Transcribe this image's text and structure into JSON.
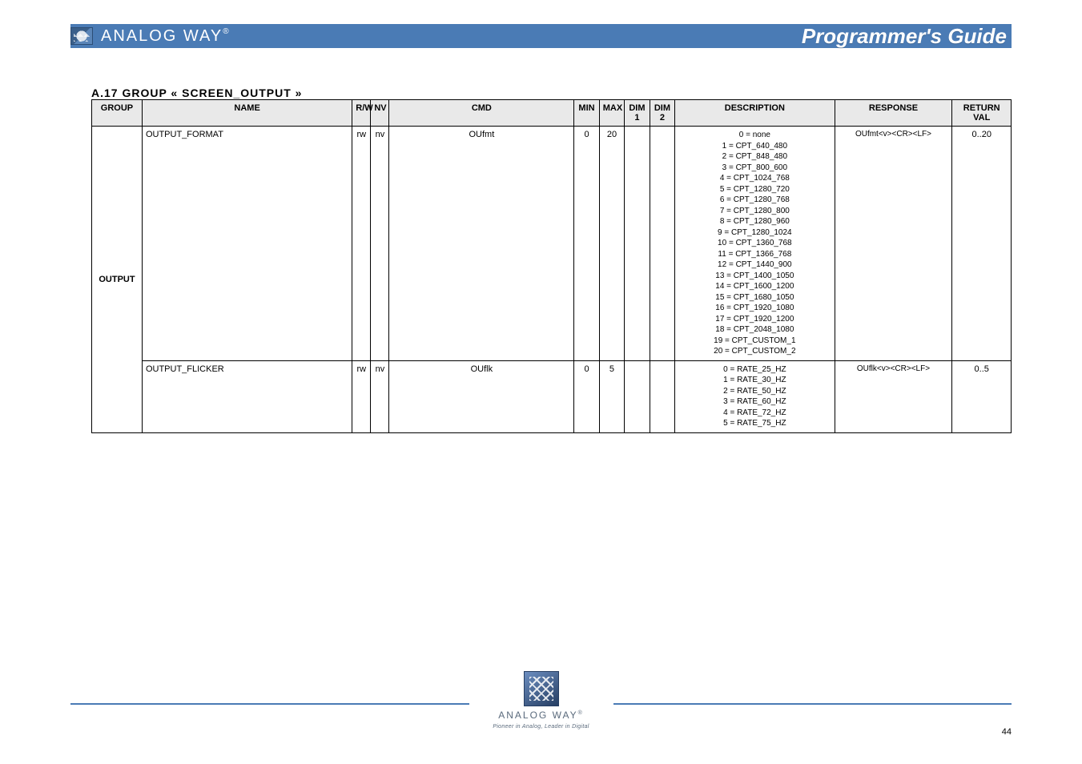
{
  "header": {
    "brand": "ANALOG WAY",
    "brand_reg": "®",
    "title": "Programmer's Guide"
  },
  "section_caption": "A.17 GROUP « SCREEN_OUTPUT »",
  "columns": [
    "GROUP",
    "NAME",
    "R/W",
    "NV",
    "CMD",
    "MIN",
    "MAX",
    "DIM 1",
    "DIM 2",
    "DESCRIPTION",
    "RESPONSE",
    "RETURN VAL"
  ],
  "rows": [
    {
      "group": "OUTPUT",
      "name": "OUTPUT_FORMAT",
      "rw": "rw",
      "nv": "nv",
      "cmd": "OUfmt",
      "min": "0",
      "max": "20",
      "d1": null,
      "d2": null,
      "desc": [
        "0 = none",
        "1 = CPT_640_480",
        "2 = CPT_848_480",
        "3 = CPT_800_600",
        "4 = CPT_1024_768",
        "5 = CPT_1280_720",
        "6 = CPT_1280_768",
        "7 = CPT_1280_800",
        "8 = CPT_1280_960",
        "9 = CPT_1280_1024",
        "10 = CPT_1360_768",
        "11 = CPT_1366_768",
        "12 = CPT_1440_900",
        "13 = CPT_1400_1050",
        "14 = CPT_1600_1200",
        "15 = CPT_1680_1050",
        "16 = CPT_1920_1080",
        "17 = CPT_1920_1200",
        "18 = CPT_2048_1080",
        "19 = CPT_CUSTOM_1",
        "20 = CPT_CUSTOM_2"
      ],
      "resp": "OUfmt<v><CR><LF>",
      "ret": "0..20"
    },
    {
      "group": "OUTPUT",
      "name": "OUTPUT_FLICKER",
      "rw": "rw",
      "nv": "nv",
      "cmd": "OUflk",
      "min": "0",
      "max": "5",
      "d1": null,
      "d2": null,
      "desc": [
        "0 = RATE_25_HZ",
        "1 = RATE_30_HZ",
        "2 = RATE_50_HZ",
        "3 = RATE_60_HZ",
        "4 = RATE_72_HZ",
        "5 = RATE_75_HZ"
      ],
      "resp": "OUflk<v><CR><LF>",
      "ret": "0..5"
    }
  ],
  "footer": {
    "brand": "ANALOG WAY",
    "brand_reg": "®",
    "tagline": "Pioneer in Analog, Leader in Digital",
    "page": "44"
  }
}
